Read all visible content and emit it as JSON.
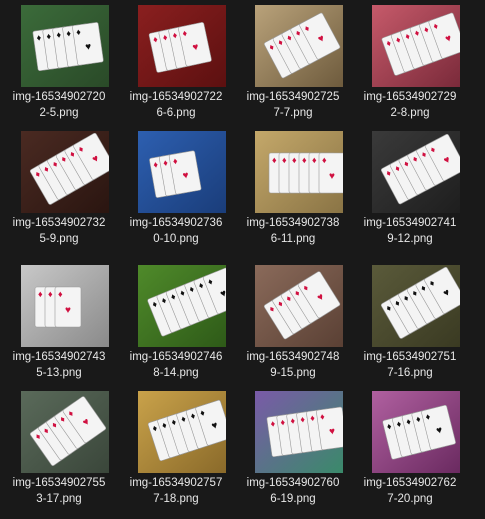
{
  "files": [
    {
      "line1": "img-16534902720",
      "line2": "2-5.png",
      "bg": "#3b6b3a",
      "bg2": "#2a4a28",
      "card": "#f4f4f4",
      "suit": "#111111",
      "icon": "image-thumbnail-icon"
    },
    {
      "line1": "img-16534902722",
      "line2": "6-6.png",
      "bg": "#8a1f1f",
      "bg2": "#5c1010",
      "card": "#f4f4f4",
      "suit": "#d01040",
      "icon": "image-thumbnail-icon"
    },
    {
      "line1": "img-16534902725",
      "line2": "7-7.png",
      "bg": "#b9a27a",
      "bg2": "#6e5b3d",
      "card": "#f4f4f4",
      "suit": "#d01040",
      "icon": "image-thumbnail-icon"
    },
    {
      "line1": "img-16534902729",
      "line2": "2-8.png",
      "bg": "#c65a6a",
      "bg2": "#7a2a3a",
      "card": "#f4f4f4",
      "suit": "#d01040",
      "icon": "image-thumbnail-icon"
    },
    {
      "line1": "img-16534902732",
      "line2": "5-9.png",
      "bg": "#4a2a22",
      "bg2": "#2a1510",
      "card": "#f4f4f4",
      "suit": "#d01040",
      "icon": "image-thumbnail-icon"
    },
    {
      "line1": "img-16534902736",
      "line2": "0-10.png",
      "bg": "#2d5fb0",
      "bg2": "#1a3d7a",
      "card": "#f4f4f4",
      "suit": "#d01040",
      "icon": "image-thumbnail-icon"
    },
    {
      "line1": "img-16534902738",
      "line2": "6-11.png",
      "bg": "#c4a86a",
      "bg2": "#8a7445",
      "card": "#f4f4f4",
      "suit": "#d01040",
      "icon": "image-thumbnail-icon"
    },
    {
      "line1": "img-16534902741",
      "line2": "9-12.png",
      "bg": "#3a3a3a",
      "bg2": "#1e1e1e",
      "card": "#f4f4f4",
      "suit": "#d01040",
      "icon": "image-thumbnail-icon"
    },
    {
      "line1": "img-16534902743",
      "line2": "5-13.png",
      "bg": "#c8c8c8",
      "bg2": "#8a8a8a",
      "card": "#f4f4f4",
      "suit": "#d01040",
      "icon": "image-thumbnail-icon"
    },
    {
      "line1": "img-16534902746",
      "line2": "8-14.png",
      "bg": "#4f8a2a",
      "bg2": "#2e5a18",
      "card": "#f4f4f4",
      "suit": "#111111",
      "icon": "image-thumbnail-icon"
    },
    {
      "line1": "img-16534902748",
      "line2": "9-15.png",
      "bg": "#8a6a5a",
      "bg2": "#5a4034",
      "card": "#f4f4f4",
      "suit": "#d01040",
      "icon": "image-thumbnail-icon"
    },
    {
      "line1": "img-16534902751",
      "line2": "7-16.png",
      "bg": "#5a5a3a",
      "bg2": "#3a3a22",
      "card": "#f4f4f4",
      "suit": "#111111",
      "icon": "image-thumbnail-icon"
    },
    {
      "line1": "img-16534902755",
      "line2": "3-17.png",
      "bg": "#5a6a5a",
      "bg2": "#3a463a",
      "card": "#f4f4f4",
      "suit": "#d01040",
      "icon": "image-thumbnail-icon"
    },
    {
      "line1": "img-16534902757",
      "line2": "7-18.png",
      "bg": "#c9a24a",
      "bg2": "#8a6a2a",
      "card": "#f4f4f4",
      "suit": "#111111",
      "icon": "image-thumbnail-icon"
    },
    {
      "line1": "img-16534902760",
      "line2": "6-19.png",
      "bg": "#7a5aa8",
      "bg2": "#3a8a6a",
      "card": "#f4f4f4",
      "suit": "#d01040",
      "icon": "image-thumbnail-icon"
    },
    {
      "line1": "img-16534902762",
      "line2": "7-20.png",
      "bg": "#b060a0",
      "bg2": "#6a2a60",
      "card": "#f4f4f4",
      "suit": "#111111",
      "icon": "image-thumbnail-icon"
    }
  ]
}
